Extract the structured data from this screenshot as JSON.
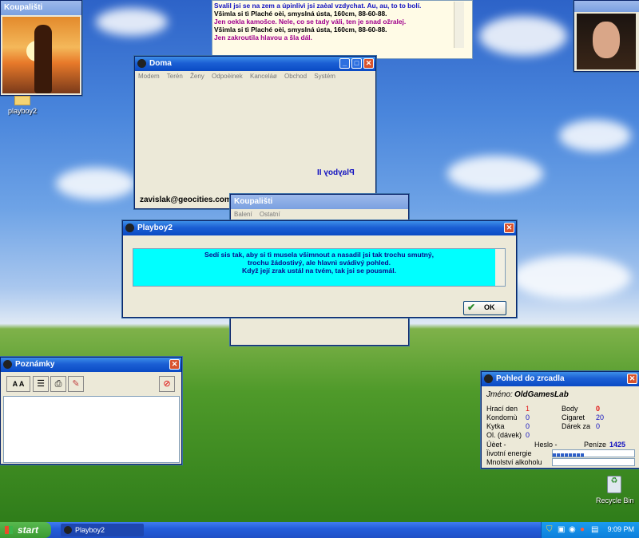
{
  "desktop": {
    "icons": [
      {
        "label": "playboy2",
        "icon": "folder-icon"
      },
      {
        "label": "Recycle Bin",
        "icon": "recycle-bin-icon"
      }
    ]
  },
  "koupaliste_top": {
    "title": "Koupališti"
  },
  "chat": {
    "lines": [
      {
        "text": "Svalil jsi se na zem a úpinlivì jsi zaèal vzdychat. Au, au, to to bolí.",
        "color": "#1010c0"
      },
      {
        "text": "Všimla si tì Plaché oèi, smyslná ústa, 160cm, 88-60-88.",
        "color": "#000000"
      },
      {
        "text": "Jen oekla kamošce. Nele, co se tady váli, ten je snad ožralej.",
        "color": "#a0008c"
      },
      {
        "text": "Všimla si tì Plaché oèi, smyslná ústa, 160cm, 88-60-88.",
        "color": "#000000"
      },
      {
        "text": "Jen zakroutila hlavou a šla dál.",
        "color": "#a0008c"
      }
    ]
  },
  "doma": {
    "title": "Doma",
    "menu": [
      "Modem",
      "Terén",
      "Ženy",
      "Odpoèinek",
      "Kanceláø",
      "Obchod",
      "Systém"
    ],
    "email": "zavislak@geocities.com",
    "logo": "Playboy II"
  },
  "koupaliste_mid": {
    "title": "Koupališti",
    "menu": [
      "Balení",
      "Ostatní"
    ]
  },
  "dialog": {
    "title": "Playboy2",
    "lines": [
      "Sedí sis tak, aby si tì musela všimnout a nasadil jsi tak trochu smutný,",
      "trochu žádostivý, ale hlavnì svádivý pohled.",
      "Když její zrak ustál na tvém, tak jsi se pousmál."
    ],
    "ok_label": "OK"
  },
  "poznamky": {
    "title": "Poznámky",
    "font_label": "A A"
  },
  "mirror": {
    "title": "Pohled do zrcadla",
    "name_label": "Jméno:",
    "name_value": "OldGamesLab",
    "left_stats": [
      {
        "label": "Hrací den",
        "value": "1"
      },
      {
        "label": "Kondomù",
        "value": "0"
      },
      {
        "label": "Kytka",
        "value": "0"
      },
      {
        "label": "Ol. (dávek)",
        "value": "0"
      }
    ],
    "right_stats": [
      {
        "label": "Body",
        "value": "0"
      },
      {
        "label": "Cigaret",
        "value": "20"
      },
      {
        "label": "Dárek za",
        "value": "0"
      }
    ],
    "ucet_label": "Úèet -",
    "heslo_label": "Heslo -",
    "penize_label": "Peníze",
    "penize_value": "1425",
    "energy_label": "Ïivotní energie",
    "energy_level": 0.4,
    "alcohol_label": "Mnolství alkoholu",
    "alcohol_level": 0.0
  },
  "taskbar": {
    "start_label": "start",
    "task_label": "Playboy2",
    "clock": "9:09 PM"
  },
  "colors": {
    "dialog_text_bg": "#00ffff",
    "dialog_text": "#0a0a8c",
    "stat_value_red": "#e01010",
    "stat_value_blue": "#1010c0"
  }
}
